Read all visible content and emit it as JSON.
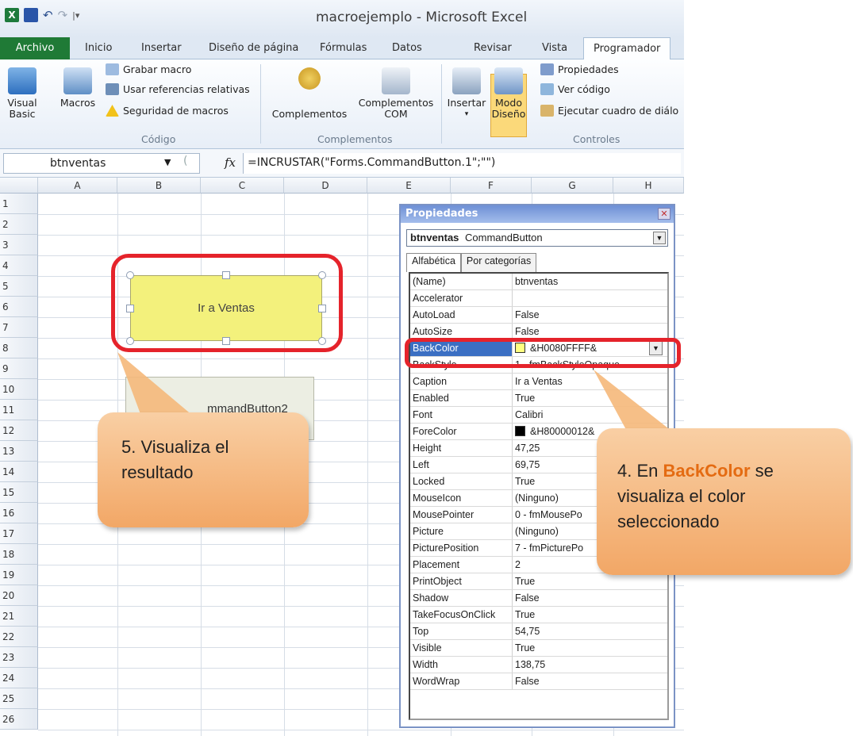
{
  "window": {
    "title": "macroejemplo - Microsoft Excel"
  },
  "tabs": [
    "Archivo",
    "Inicio",
    "Insertar",
    "Diseño de página",
    "Fórmulas",
    "Datos",
    "Revisar",
    "Vista",
    "Programador"
  ],
  "ribbon": {
    "codigo": {
      "visual_basic": "Visual Basic",
      "macros": "Macros",
      "grabar": "Grabar macro",
      "referencias": "Usar referencias relativas",
      "seguridad": "Seguridad de macros",
      "label": "Código"
    },
    "complementos": {
      "complementos": "Complementos",
      "complementos_com": "Complementos COM",
      "label": "Complementos"
    },
    "controles": {
      "insertar": "Insertar",
      "modo_diseno": "Modo Diseño",
      "propiedades": "Propiedades",
      "ver_codigo": "Ver código",
      "ejecutar": "Ejecutar cuadro de diálo",
      "label": "Controles"
    }
  },
  "formula_bar": {
    "name_box": "btnventas",
    "fx": "fx",
    "formula": "=INCRUSTAR(\"Forms.CommandButton.1\";\"\")"
  },
  "grid": {
    "columns": [
      "A",
      "B",
      "C",
      "D",
      "E",
      "F",
      "G",
      "H"
    ],
    "rows": [
      "1",
      "2",
      "3",
      "4",
      "5",
      "6",
      "7",
      "8",
      "9",
      "10",
      "11",
      "12",
      "13",
      "14",
      "15",
      "16",
      "17",
      "18",
      "19",
      "20",
      "21",
      "22",
      "23",
      "24",
      "25",
      "26"
    ]
  },
  "sheet": {
    "button1_caption": "Ir a Ventas",
    "button2_caption": "mmandButton2"
  },
  "callouts": {
    "left": "5. Visualiza el resultado",
    "right_prefix": "4. En ",
    "right_highlight": "BackColor",
    "right_suffix": " se visualiza el color seleccionado"
  },
  "properties": {
    "title": "Propiedades",
    "object_name": "btnventas",
    "object_type": "CommandButton",
    "tab_alpha": "Alfabética",
    "tab_category": "Por categorías",
    "rows": [
      {
        "k": "(Name)",
        "v": "btnventas"
      },
      {
        "k": "Accelerator",
        "v": ""
      },
      {
        "k": "AutoLoad",
        "v": "False"
      },
      {
        "k": "AutoSize",
        "v": "False"
      },
      {
        "k": "BackColor",
        "v": "&H0080FFFF&"
      },
      {
        "k": "BackStyle",
        "v": "1 - fmBackStyleOpaque"
      },
      {
        "k": "Caption",
        "v": "Ir a Ventas"
      },
      {
        "k": "Enabled",
        "v": "True"
      },
      {
        "k": "Font",
        "v": "Calibri"
      },
      {
        "k": "ForeColor",
        "v": "&H80000012&"
      },
      {
        "k": "Height",
        "v": "47,25"
      },
      {
        "k": "Left",
        "v": "69,75"
      },
      {
        "k": "Locked",
        "v": "True"
      },
      {
        "k": "MouseIcon",
        "v": "(Ninguno)"
      },
      {
        "k": "MousePointer",
        "v": "0 - fmMousePo"
      },
      {
        "k": "Picture",
        "v": "(Ninguno)"
      },
      {
        "k": "PicturePosition",
        "v": "7 - fmPicturePo"
      },
      {
        "k": "Placement",
        "v": "2"
      },
      {
        "k": "PrintObject",
        "v": "True"
      },
      {
        "k": "Shadow",
        "v": "False"
      },
      {
        "k": "TakeFocusOnClick",
        "v": "True"
      },
      {
        "k": "Top",
        "v": "54,75"
      },
      {
        "k": "Visible",
        "v": "True"
      },
      {
        "k": "Width",
        "v": "138,75"
      },
      {
        "k": "WordWrap",
        "v": "False"
      }
    ]
  },
  "colors": {
    "accent_red": "#e5232b",
    "button_yellow": "#f3f17c",
    "callout_orange": "#f2a766",
    "selection_blue": "#3b6fc3"
  }
}
